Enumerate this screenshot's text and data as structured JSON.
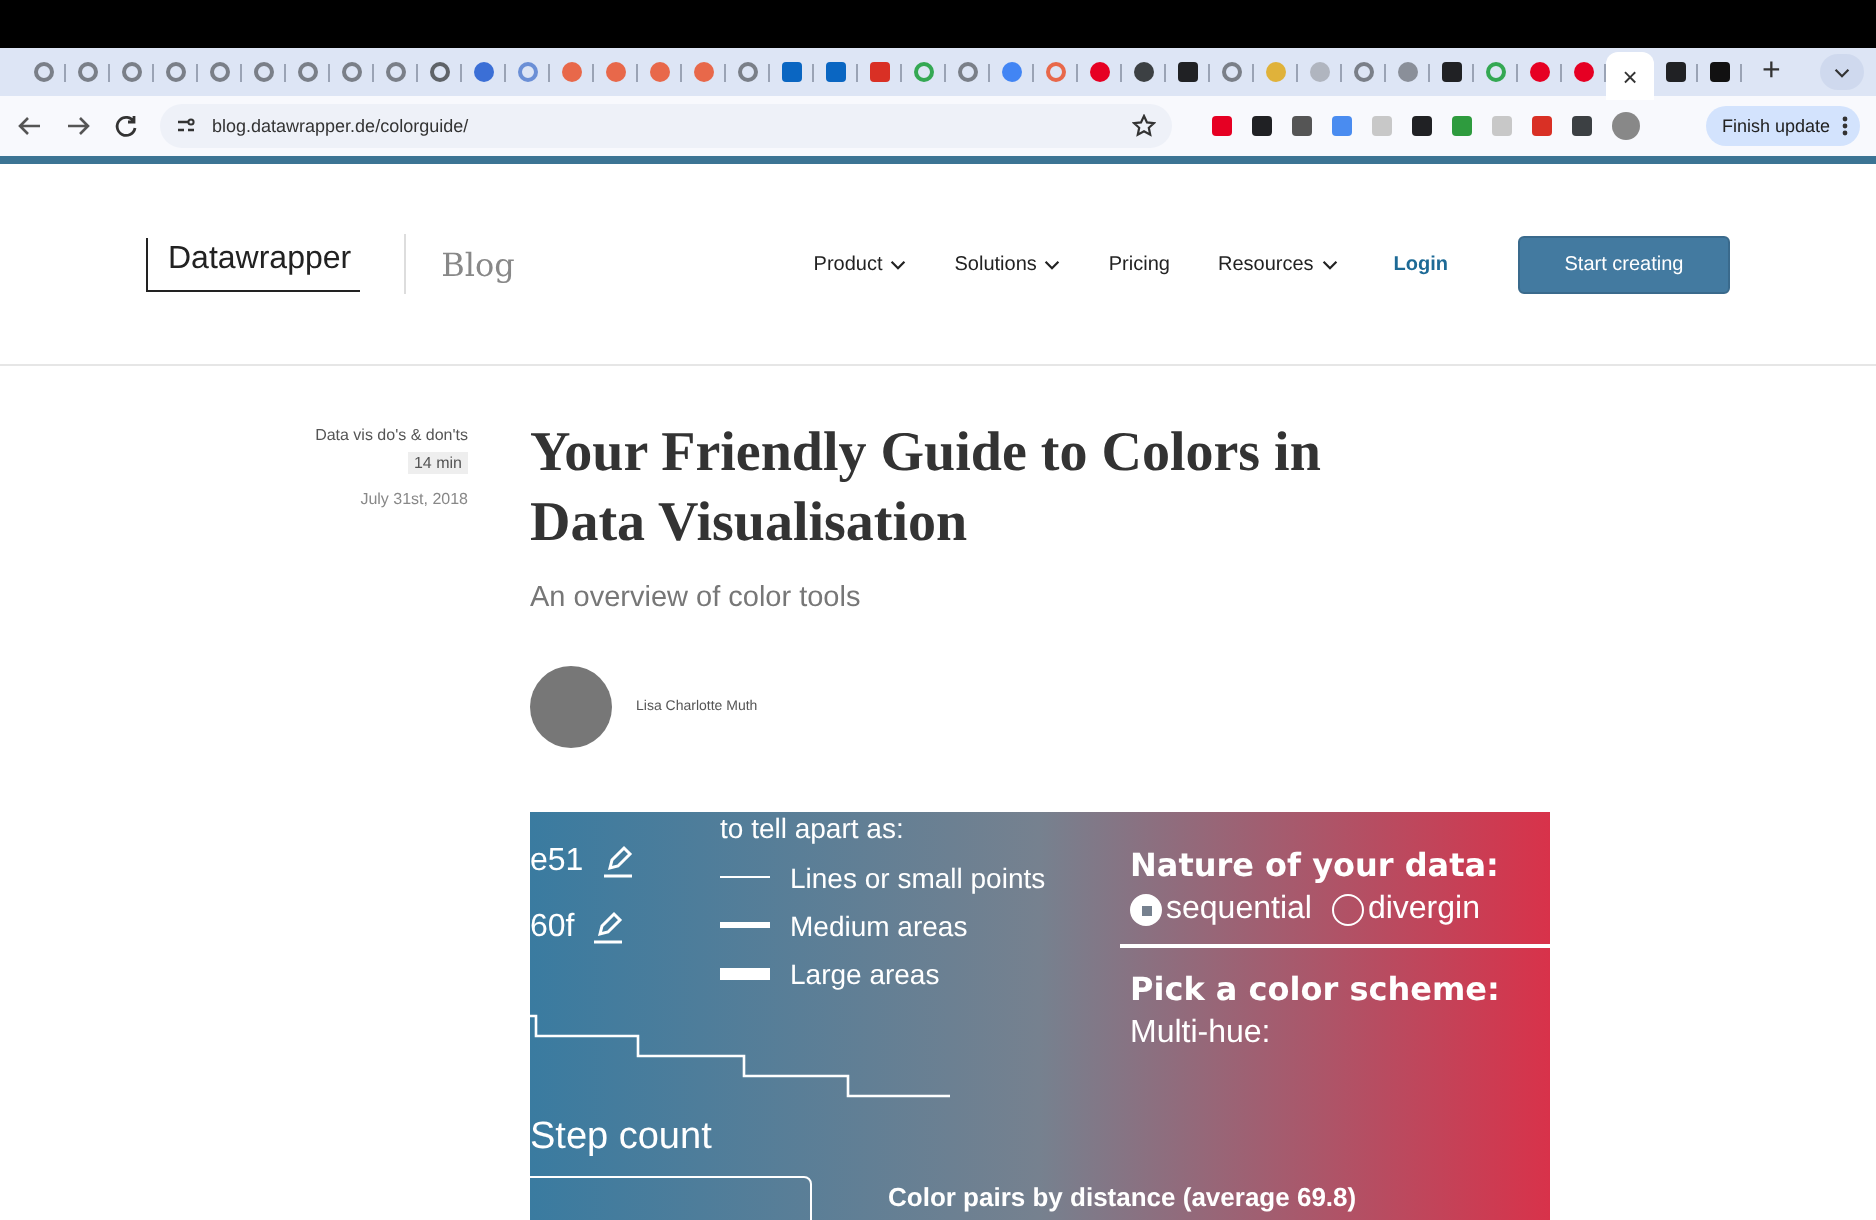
{
  "browser": {
    "tabs": [
      {
        "kind": "ring",
        "color": "#7a7f88",
        "selected": false
      },
      {
        "kind": "ring",
        "color": "#7a7f88",
        "selected": false
      },
      {
        "kind": "ring",
        "color": "#7a7f88",
        "selected": false
      },
      {
        "kind": "ring",
        "color": "#7a7f88",
        "selected": false
      },
      {
        "kind": "ring",
        "color": "#7a7f88",
        "selected": false
      },
      {
        "kind": "ring",
        "color": "#7a7f88",
        "selected": false
      },
      {
        "kind": "ring",
        "color": "#7a7f88",
        "selected": false
      },
      {
        "kind": "ring",
        "color": "#7a7f88",
        "selected": false
      },
      {
        "kind": "ring",
        "color": "#7a7f88",
        "selected": false
      },
      {
        "kind": "ring",
        "color": "#5f6368",
        "selected": false
      },
      {
        "kind": "dot",
        "color": "#3b6fd6",
        "selected": false
      },
      {
        "kind": "ring",
        "color": "#6b8fd6",
        "selected": false
      },
      {
        "kind": "dot",
        "color": "#e8684a",
        "selected": false
      },
      {
        "kind": "dot",
        "color": "#e8684a",
        "selected": false
      },
      {
        "kind": "dot",
        "color": "#e8684a",
        "selected": false
      },
      {
        "kind": "dot",
        "color": "#e8684a",
        "selected": false
      },
      {
        "kind": "ring",
        "color": "#7a7f88",
        "selected": false
      },
      {
        "kind": "square",
        "color": "#0a66c2",
        "selected": false
      },
      {
        "kind": "square",
        "color": "#0a66c2",
        "selected": false
      },
      {
        "kind": "square",
        "color": "#d93025",
        "selected": false
      },
      {
        "kind": "ring",
        "color": "#34a853",
        "selected": false
      },
      {
        "kind": "ring",
        "color": "#7a7f88",
        "selected": false
      },
      {
        "kind": "dot",
        "color": "#4285f4",
        "selected": false
      },
      {
        "kind": "ring",
        "color": "#e8684a",
        "selected": false
      },
      {
        "kind": "dot",
        "color": "#e60023",
        "selected": false
      },
      {
        "kind": "dot",
        "color": "#3c4043",
        "selected": false
      },
      {
        "kind": "square",
        "color": "#202124",
        "selected": false
      },
      {
        "kind": "ring",
        "color": "#7a7f88",
        "selected": false
      },
      {
        "kind": "dot",
        "color": "#e0b23a",
        "selected": false
      },
      {
        "kind": "dot",
        "color": "#b0b5bf",
        "selected": false
      },
      {
        "kind": "ring",
        "color": "#7a7f88",
        "selected": false
      },
      {
        "kind": "dot",
        "color": "#8a8f99",
        "selected": false
      },
      {
        "kind": "square",
        "color": "#202124",
        "selected": false
      },
      {
        "kind": "ring",
        "color": "#34a853",
        "selected": false
      },
      {
        "kind": "dot",
        "color": "#e60023",
        "selected": false
      },
      {
        "kind": "dot",
        "color": "#e60023",
        "selected": false
      },
      {
        "selected": true
      },
      {
        "kind": "square",
        "color": "#202124",
        "selected": false
      },
      {
        "kind": "square",
        "color": "#111111",
        "selected": false
      }
    ],
    "close_glyph": "×",
    "new_tab": "+",
    "url": "blog.datawrapper.de/colorguide/",
    "extensions": [
      {
        "color": "#e60023"
      },
      {
        "color": "#202124"
      },
      {
        "color": "#555555"
      },
      {
        "color": "#4a8cf0"
      },
      {
        "color": "#c8c8c8"
      },
      {
        "color": "#202124"
      },
      {
        "color": "#2e9b3e"
      },
      {
        "color": "#c8c8c8"
      },
      {
        "color": "#d93025"
      },
      {
        "color": "#3c4043"
      }
    ],
    "update_button": "Finish update"
  },
  "header": {
    "logo": "Datawrapper",
    "section": "Blog",
    "nav": [
      {
        "label": "Product",
        "dropdown": true
      },
      {
        "label": "Solutions",
        "dropdown": true
      },
      {
        "label": "Pricing",
        "dropdown": false
      },
      {
        "label": "Resources",
        "dropdown": true
      }
    ],
    "login": "Login",
    "cta": "Start creating"
  },
  "article": {
    "category": "Data vis do's & don'ts",
    "reading_time": "14 min",
    "date": "July 31st, 2018",
    "title": "Your Friendly Guide to Colors in Data Visualisation",
    "subtitle": "An overview of color tools",
    "author": "Lisa Charlotte Muth",
    "figure": {
      "intro": "to tell apart as:",
      "hex_values": [
        "e51",
        "60f"
      ],
      "legend": [
        {
          "label": "Lines or small points",
          "kind": "thin"
        },
        {
          "label": "Medium areas",
          "kind": "medium"
        },
        {
          "label": "Large areas",
          "kind": "thick"
        }
      ],
      "nature_heading": "Nature of your data:",
      "options": [
        {
          "label": "sequential",
          "selected": true
        },
        {
          "label": "divergin",
          "selected": false
        }
      ],
      "scheme_heading": "Pick a color scheme:",
      "scheme_type": "Multi-hue:",
      "step_label": "Step count",
      "pairs_heading": "Color pairs by distance (average 69.8)"
    }
  }
}
